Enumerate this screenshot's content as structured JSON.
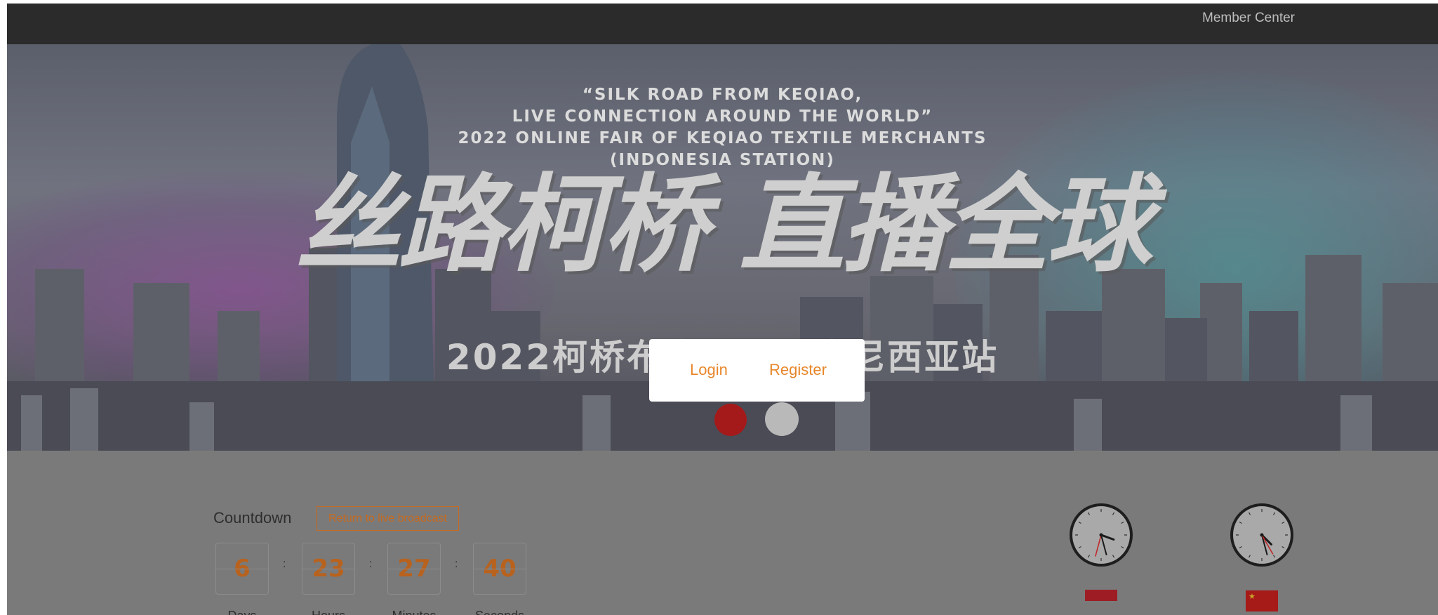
{
  "header": {
    "member_center": "Member Center"
  },
  "banner": {
    "en_title_lines": [
      "“SILK ROAD FROM KEQIAO,",
      "LIVE CONNECTION AROUND THE WORLD”",
      "2022 ONLINE FAIR OF KEQIAO TEXTILE MERCHANTS",
      "(INDONESIA STATION)"
    ],
    "cn_title": "丝路柯桥 直播全球",
    "cn_subtitle": "2022柯桥布商云展印度尼西亚站"
  },
  "popup": {
    "login": "Login",
    "register": "Register"
  },
  "countdown": {
    "label": "Countdown",
    "return_button": "Return to live broadcast",
    "days": "6",
    "hours": "23",
    "minutes": "27",
    "seconds": "40",
    "separator": ":",
    "units": [
      "Days",
      "Hours",
      "Minutes",
      "Seconds"
    ]
  },
  "clocks": [
    {
      "name": "indonesia-clock",
      "flag": "indonesia-flag",
      "hour_deg": 110,
      "minute_deg": 165,
      "second_deg": 195
    },
    {
      "name": "china-clock",
      "flag": "china-flag",
      "hour_deg": 135,
      "minute_deg": 165,
      "second_deg": 150
    }
  ],
  "colors": {
    "accent": "#e8862a",
    "overlay": "#7a7a7a",
    "topbar": "#2b2b2b"
  }
}
